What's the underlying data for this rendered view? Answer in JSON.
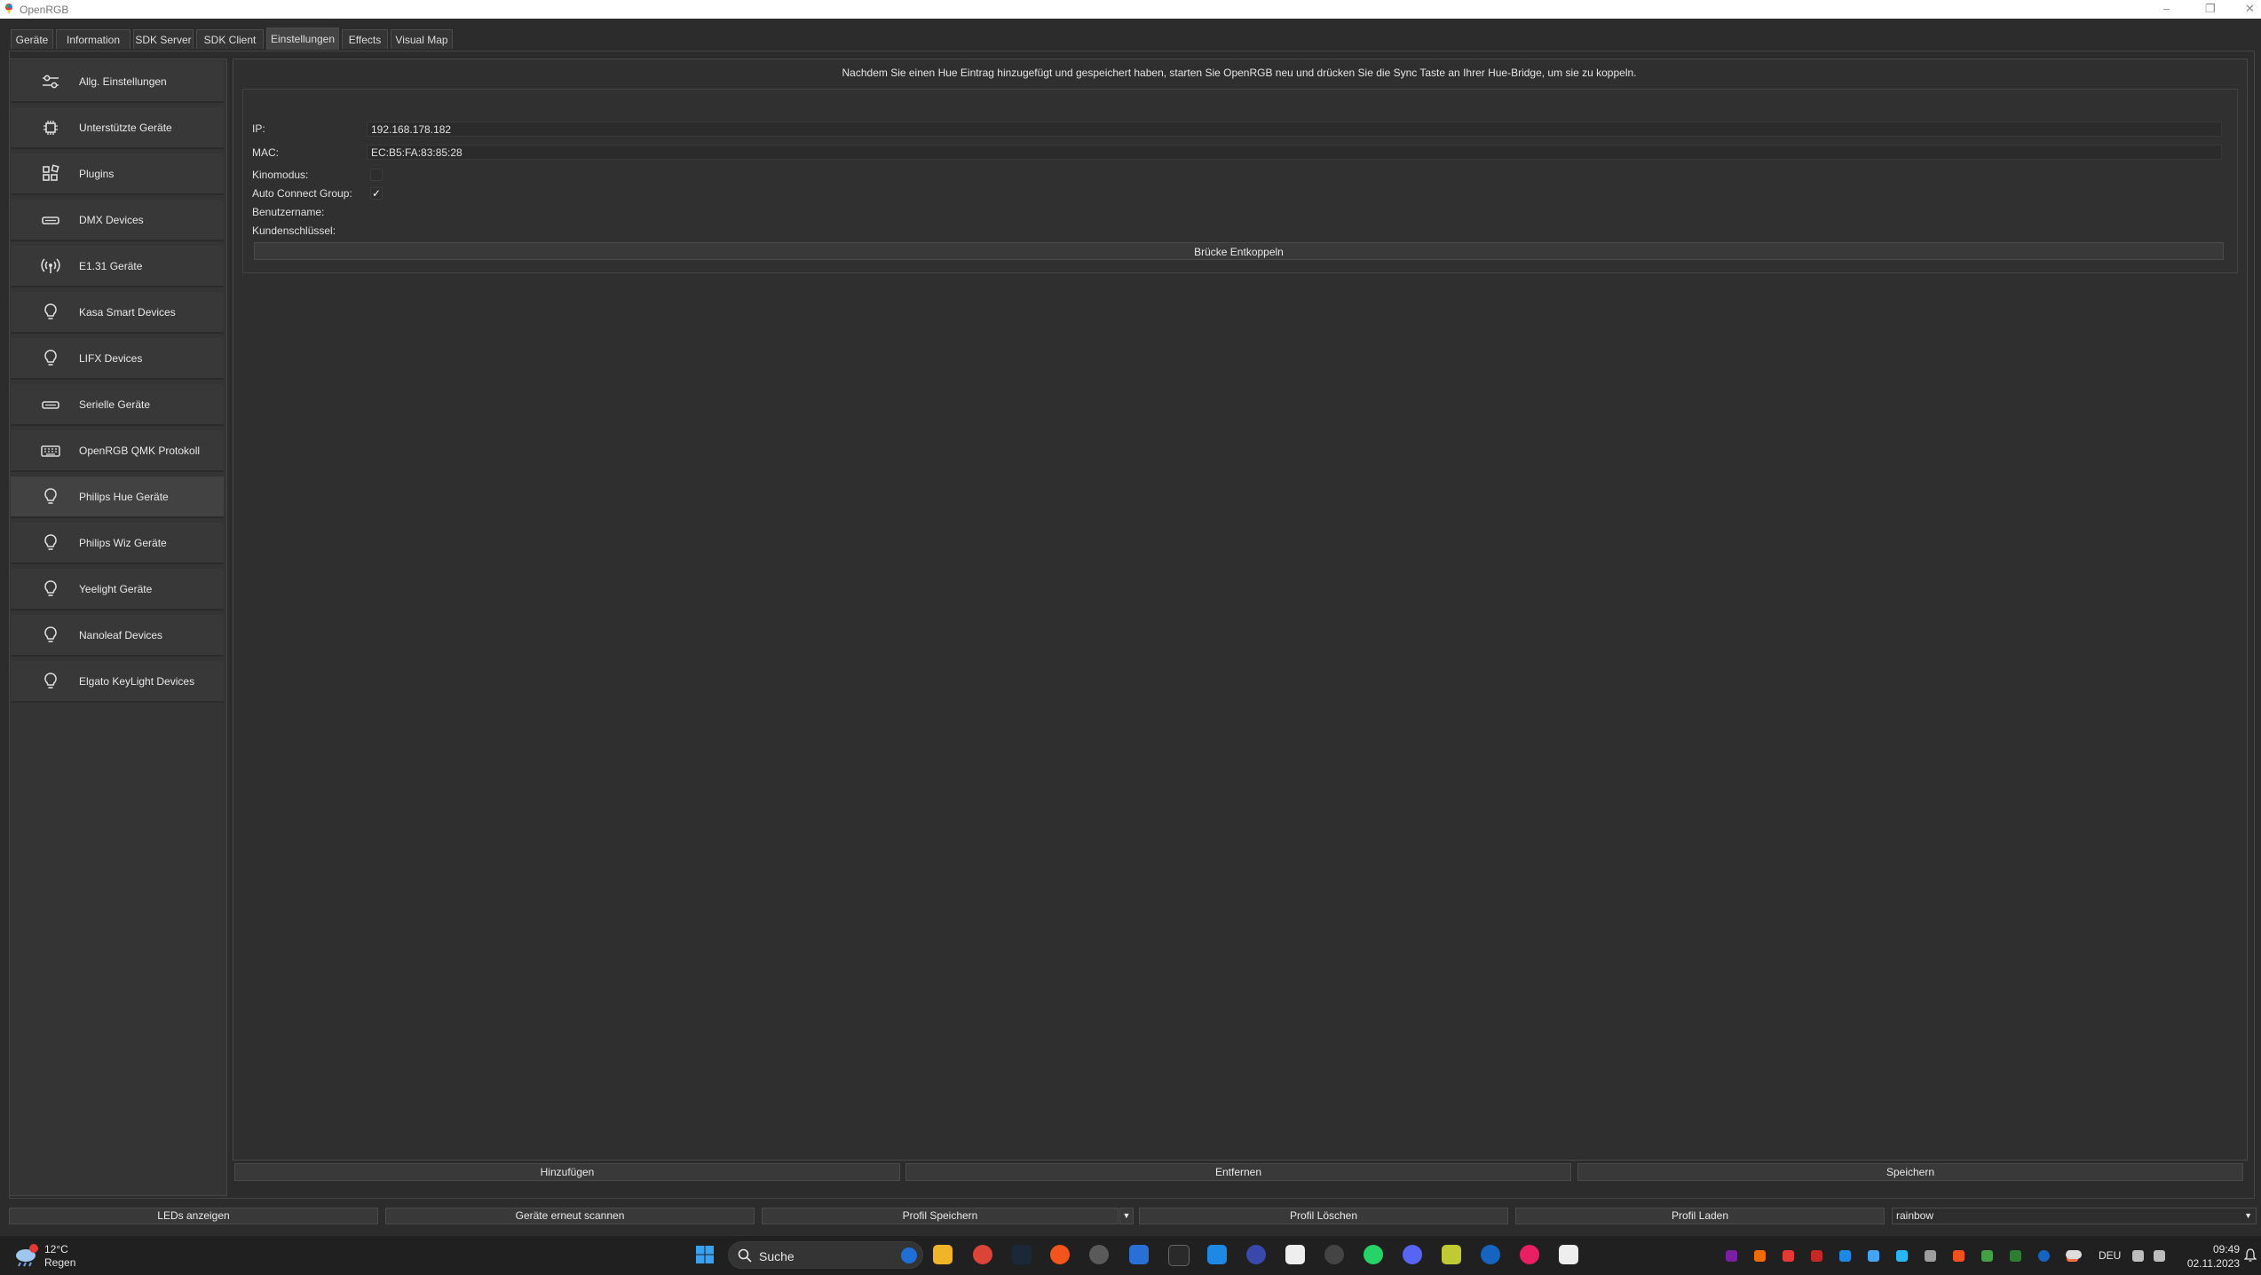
{
  "window": {
    "title": "OpenRGB"
  },
  "tabs": [
    {
      "label": "Geräte"
    },
    {
      "label": "Information"
    },
    {
      "label": "SDK Server"
    },
    {
      "label": "SDK Client"
    },
    {
      "label": "Einstellungen"
    },
    {
      "label": "Effects"
    },
    {
      "label": "Visual Map"
    }
  ],
  "active_tab": "Einstellungen",
  "sidebar": {
    "items": [
      {
        "label": "Allg. Einstellungen",
        "icon": "sliders-icon"
      },
      {
        "label": "Unterstützte Geräte",
        "icon": "chip-icon"
      },
      {
        "label": "Plugins",
        "icon": "plugins-icon"
      },
      {
        "label": "DMX Devices",
        "icon": "connector-icon"
      },
      {
        "label": "E1.31 Geräte",
        "icon": "broadcast-icon"
      },
      {
        "label": "Kasa Smart Devices",
        "icon": "bulb-icon"
      },
      {
        "label": "LIFX Devices",
        "icon": "bulb-icon"
      },
      {
        "label": "Serielle Geräte",
        "icon": "connector-icon"
      },
      {
        "label": "OpenRGB QMK Protokoll",
        "icon": "keyboard-icon"
      },
      {
        "label": "Philips Hue Geräte",
        "icon": "bulb-icon"
      },
      {
        "label": "Philips Wiz Geräte",
        "icon": "bulb-icon"
      },
      {
        "label": "Yeelight Geräte",
        "icon": "bulb-icon"
      },
      {
        "label": "Nanoleaf Devices",
        "icon": "bulb-icon"
      },
      {
        "label": "Elgato KeyLight Devices",
        "icon": "bulb-icon"
      }
    ],
    "active": "Philips Hue Geräte"
  },
  "hue": {
    "hint": "Nachdem Sie einen Hue Eintrag hinzugefügt und gespeichert haben, starten Sie OpenRGB neu und drücken Sie die Sync Taste an Ihrer Hue-Bridge, um sie zu koppeln.",
    "ip_label": "IP:",
    "ip_value": "192.168.178.182",
    "mac_label": "MAC:",
    "mac_value": "EC:B5:FA:83:85:28",
    "kino_label": "Kinomodus:",
    "kino_checked": false,
    "autoconnect_label": "Auto Connect Group:",
    "autoconnect_mark": "✓",
    "username_label": "Benutzername:",
    "clientkey_label": "Kundenschlüssel:",
    "unpair_label": "Brücke Entkoppeln",
    "add_label": "Hinzufügen",
    "remove_label": "Entfernen",
    "save_label": "Speichern"
  },
  "footer": {
    "show_leds": "LEDs anzeigen",
    "rescan": "Geräte erneut scannen",
    "save_profile": "Profil Speichern",
    "delete_profile": "Profil Löschen",
    "load_profile": "Profil Laden",
    "profile_value": "rainbow"
  },
  "taskbar": {
    "weather_temp": "12°C",
    "weather_desc": "Regen",
    "search_label": "Suche",
    "language": "DEU",
    "time": "09:49",
    "date": "02.11.2023"
  },
  "colors": {
    "background": "#2c2c2c",
    "panel": "#343434",
    "button": "#393939",
    "taskbar": "#202020"
  }
}
